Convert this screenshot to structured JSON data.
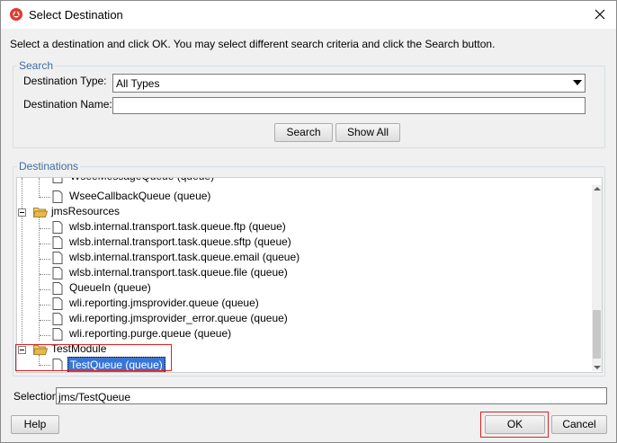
{
  "window": {
    "title": "Select Destination",
    "instruction": "Select a destination and click OK. You may select different search criteria and click the Search button."
  },
  "search": {
    "group_title": "Search",
    "destination_type_label": "Destination Type:",
    "destination_type_value": "All Types",
    "destination_name_label": "Destination Name:",
    "destination_name_value": "",
    "search_button": "Search",
    "show_all_button": "Show All"
  },
  "destinations": {
    "group_title": "Destinations",
    "items": [
      {
        "label": "WseeMessageQueue (queue)",
        "type": "queue"
      },
      {
        "label": "WseeCallbackQueue (queue)",
        "type": "queue"
      },
      {
        "label": "jmsResources",
        "type": "folder"
      },
      {
        "label": "wlsb.internal.transport.task.queue.ftp (queue)",
        "type": "queue"
      },
      {
        "label": "wlsb.internal.transport.task.queue.sftp (queue)",
        "type": "queue"
      },
      {
        "label": "wlsb.internal.transport.task.queue.email (queue)",
        "type": "queue"
      },
      {
        "label": "wlsb.internal.transport.task.queue.file (queue)",
        "type": "queue"
      },
      {
        "label": "QueueIn (queue)",
        "type": "queue"
      },
      {
        "label": "wli.reporting.jmsprovider.queue (queue)",
        "type": "queue"
      },
      {
        "label": "wli.reporting.jmsprovider_error.queue (queue)",
        "type": "queue"
      },
      {
        "label": "wli.reporting.purge.queue (queue)",
        "type": "queue"
      },
      {
        "label": "TestModule",
        "type": "folder"
      },
      {
        "label": "TestQueue (queue)",
        "type": "queue",
        "selected": true
      }
    ]
  },
  "selection": {
    "label": "Selection:",
    "value": "jms/TestQueue"
  },
  "buttons": {
    "help": "Help",
    "ok": "OK",
    "cancel": "Cancel"
  },
  "colors": {
    "group_title": "#3c6ea5",
    "selection_highlight": "#3875d7",
    "annotation_box": "#e02020",
    "folder": "#e8b84a"
  }
}
